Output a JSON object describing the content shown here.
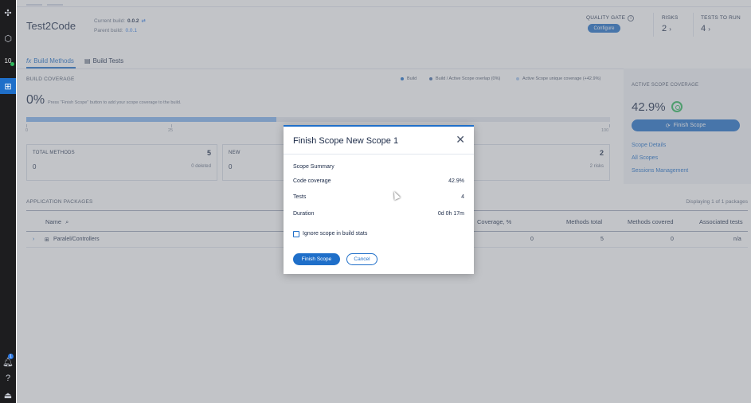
{
  "app": {
    "title": "Test2Code",
    "current_build_label": "Current build:",
    "current_build": "0.0.2",
    "parent_build_label": "Parent build:",
    "parent_build": "0.0.1"
  },
  "rail": {
    "build_count": "10"
  },
  "header": {
    "quality_gate_label": "QUALITY GATE",
    "configure_label": "Configure",
    "risks_label": "RISKS",
    "risks_value": "2",
    "tests_to_run_label": "TESTS TO RUN",
    "tests_to_run_value": "4"
  },
  "tabs": [
    {
      "label": "Build Methods",
      "active": true
    },
    {
      "label": "Build Tests",
      "active": false
    }
  ],
  "build_coverage": {
    "heading": "BUILD COVERAGE",
    "legend": [
      "Build",
      "Build / Active Scope overlap (0%)",
      "Active Scope unique coverage (+42.9%)"
    ],
    "value": "0%",
    "hint": "Press \"Finish Scope\" button to add your scope coverage to the build.",
    "ticks": [
      "0",
      "25",
      "100"
    ]
  },
  "cards": [
    {
      "label": "TOTAL METHODS",
      "value": "5",
      "zero": "0",
      "sub": "0 deleted"
    },
    {
      "label": "NEW",
      "value": "",
      "zero": "0",
      "sub": ""
    },
    {
      "label": "",
      "value": "2",
      "zero": "",
      "sub": "2 risks"
    }
  ],
  "active_scope": {
    "heading": "ACTIVE SCOPE COVERAGE",
    "value": "42.9%",
    "finish_label": "Finish Scope",
    "links": [
      "Scope Details",
      "All Scopes",
      "Sessions Management"
    ]
  },
  "packages": {
    "heading": "APPLICATION PACKAGES",
    "count": "Displaying 1 of 1 packages",
    "columns": [
      "Name",
      "Coverage, %",
      "Methods total",
      "Methods covered",
      "Associated tests"
    ],
    "rows": [
      {
        "name": "Paralel/Controllers",
        "coverage": "0",
        "methods_total": "5",
        "methods_covered": "0",
        "associated_tests": "n/a"
      }
    ]
  },
  "modal": {
    "title": "Finish Scope New Scope 1",
    "summary_heading": "Scope Summary",
    "rows": [
      {
        "label": "Code coverage",
        "value": "42.9%"
      },
      {
        "label": "Tests",
        "value": "4"
      },
      {
        "label": "Duration",
        "value": "0d 0h 17m"
      }
    ],
    "checkbox_label": "Ignore scope in build stats",
    "finish_label": "Finish Scope",
    "cancel_label": "Cancel"
  },
  "colors": {
    "accent": "#1f6fc9",
    "success": "#2eb85c",
    "rail": "#1d1d1f"
  }
}
